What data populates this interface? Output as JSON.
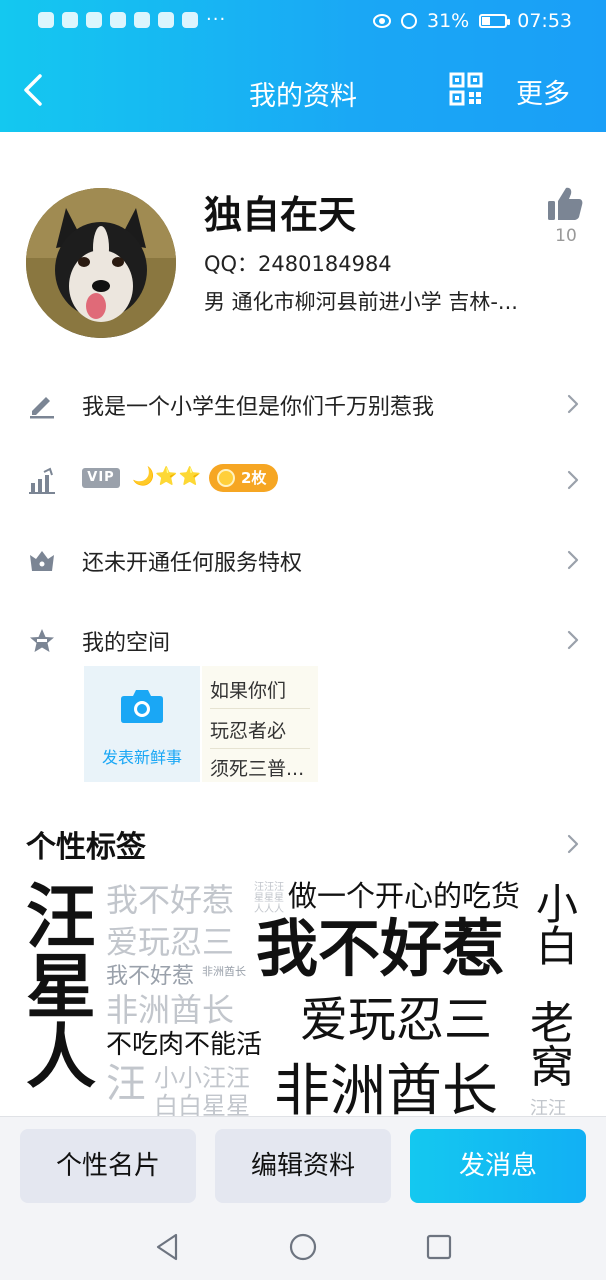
{
  "status_bar": {
    "dots": "···",
    "battery_text": "31%",
    "battery_level": 0.31,
    "time": "07:53"
  },
  "nav": {
    "title": "我的资料",
    "more": "更多"
  },
  "profile": {
    "nickname": "独自在天",
    "qq": "QQ：2480184984",
    "info": "男  通化市柳河县前进小学  吉林-...",
    "like_count": "10"
  },
  "rows": {
    "signature": "我是一个小学生但是你们千万别惹我",
    "vip_label": "VIP",
    "vip_icons": "🌙⭐⭐",
    "coins": "2枚",
    "service": "还未开通任何服务特权",
    "space": "我的空间"
  },
  "space": {
    "post_label": "发表新鲜事",
    "preview_lines": [
      "如果你们",
      "玩忍者必",
      "须死三普..."
    ]
  },
  "tags": {
    "title": "个性标签",
    "cloud": {
      "wang_vertical": "汪星人",
      "bubuhaore_gray": "我不好惹",
      "zuoyige": "做一个开心的吃货",
      "xiaobai": "小白",
      "aiwanren_gray": "爱玩忍三",
      "wobuhaore_big": "我不好惹",
      "laowo": "老窝",
      "wobuhaore_small": "我不好惹",
      "feizhou_tiny": "非洲酋长",
      "feizhou_gray": "非洲酋长",
      "aiwanren_big": "爱玩忍三",
      "buchirou": "不吃肉不能活",
      "wang_gray": "汪",
      "xiaoxiao": "小小汪汪",
      "baibai": "白白星星",
      "feizhou_big": "非洲酋长",
      "wangwang_small": "汪汪",
      "tiny_wangxing_a": "汪汪汪",
      "tiny_wangxing_b": "星星星",
      "tiny_wangxing_c": "人人人"
    }
  },
  "buttons": {
    "card": "个性名片",
    "edit": "编辑资料",
    "message": "发消息"
  },
  "colors": {
    "accent": "#1aa7f5",
    "header_start": "#14c8f0",
    "coin": "#f6a623"
  }
}
